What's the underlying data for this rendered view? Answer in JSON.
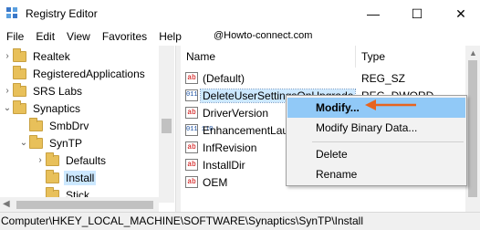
{
  "window": {
    "title": "Registry Editor",
    "minimize_glyph": "—",
    "maximize_glyph": "☐",
    "close_glyph": "✕"
  },
  "menu": [
    "File",
    "Edit",
    "View",
    "Favorites",
    "Help"
  ],
  "watermark": "@Howto-connect.com",
  "tree": {
    "items": [
      {
        "label": "Realtek",
        "expander": "›"
      },
      {
        "label": "RegisteredApplications",
        "expander": ""
      },
      {
        "label": "SRS Labs",
        "expander": "›"
      },
      {
        "label": "Synaptics",
        "expander": "⌄"
      },
      {
        "label": "SmbDrv",
        "expander": ""
      },
      {
        "label": "SynTP",
        "expander": "⌄"
      },
      {
        "label": "Defaults",
        "expander": "›"
      },
      {
        "label": "Install",
        "expander": ""
      },
      {
        "label": "Stick",
        "expander": ""
      }
    ],
    "selected": "Install"
  },
  "values": {
    "headers": {
      "name": "Name",
      "type": "Type"
    },
    "rows": [
      {
        "icon": "ab",
        "name": "(Default)",
        "type": "REG_SZ"
      },
      {
        "icon": "011\n110",
        "name": "DeleteUserSettingsOnUpgrade",
        "type": "REG_DWORD"
      },
      {
        "icon": "ab",
        "name": "DriverVersion",
        "type": ""
      },
      {
        "icon": "011\n110",
        "name": "EnhancementLauncher",
        "type": ""
      },
      {
        "icon": "ab",
        "name": "InfRevision",
        "type": ""
      },
      {
        "icon": "ab",
        "name": "InstallDir",
        "type": ""
      },
      {
        "icon": "ab",
        "name": "OEM",
        "type": ""
      }
    ]
  },
  "context_menu": {
    "items": [
      "Modify...",
      "Modify Binary Data...",
      "Delete",
      "Rename"
    ],
    "highlighted": "Modify..."
  },
  "status_bar": "Computer\\HKEY_LOCAL_MACHINE\\SOFTWARE\\Synaptics\\SynTP\\Install",
  "colors": {
    "selection": "#cce8ff",
    "menu_highlight": "#91c9f7",
    "arrow": "#e8641e",
    "folder": "#e8c05a"
  }
}
